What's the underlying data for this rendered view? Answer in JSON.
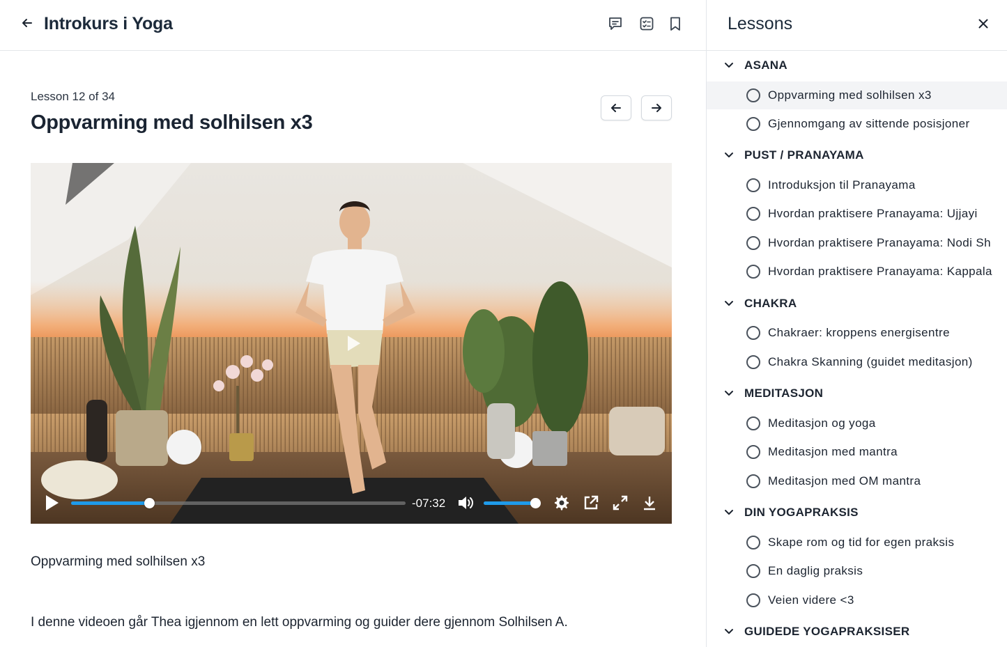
{
  "header": {
    "back_icon": "arrow-left-icon",
    "course_title": "Introkurs i Yoga",
    "icons": [
      "chat-icon",
      "checklist-icon",
      "bookmark-icon"
    ]
  },
  "lesson": {
    "counter": "Lesson 12 of 34",
    "title": "Oppvarming med solhilsen x3",
    "prev_icon": "arrow-left-icon",
    "next_icon": "arrow-right-icon"
  },
  "video": {
    "time_remaining": "-07:32",
    "progress_fraction": 0.235,
    "volume_fraction": 0.98,
    "accent_color": "#1f9bea"
  },
  "description": {
    "line1": "Oppvarming med solhilsen x3",
    "line2": "I denne videoen går Thea igjennom en lett oppvarming og guider dere gjennom Solhilsen A."
  },
  "sidebar": {
    "title": "Lessons",
    "close_icon": "close-icon",
    "sections": [
      {
        "label": "ASANA",
        "items": [
          "Oppvarming med solhilsen x3",
          "Gjennomgang av sittende posisjoner"
        ]
      },
      {
        "label": "PUST / PRANAYAMA",
        "items": [
          "Introduksjon til Pranayama",
          "Hvordan praktisere Pranayama: Ujjayi",
          "Hvordan praktisere Pranayama: Nodi Sh",
          "Hvordan praktisere Pranayama: Kappala"
        ]
      },
      {
        "label": "CHAKRA",
        "items": [
          "Chakraer: kroppens energisentre",
          "Chakra Skanning (guidet meditasjon)"
        ]
      },
      {
        "label": "MEDITASJON",
        "items": [
          "Meditasjon og yoga",
          "Meditasjon med mantra",
          "Meditasjon med OM mantra"
        ]
      },
      {
        "label": "DIN YOGAPRAKSIS",
        "items": [
          "Skape rom og tid for egen praksis",
          "En daglig praksis",
          "Veien videre <3"
        ]
      },
      {
        "label": "GUIDEDE YOGAPRAKSISER",
        "items": []
      }
    ]
  }
}
